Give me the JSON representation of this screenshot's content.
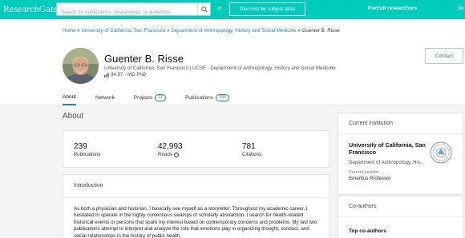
{
  "topbar": {
    "logo": "ResearchGate",
    "search_placeholder": "Search for publications, researchers, or questions",
    "or": "or",
    "discover": "Discover by subject area",
    "recruit": "Recruit researchers",
    "join": "Jo"
  },
  "breadcrumb": {
    "home": "Home",
    "sep": "»",
    "institution": "University of California, San Francisco",
    "department": "Department of Anthropology, History and Social Medicine",
    "current": "Guenter B. Risse"
  },
  "profile": {
    "name": "Guenter B. Risse",
    "affiliation": "University of California, San Francisco | UCSF · Department of Anthropology, History and Social Medicine",
    "score": "34.57",
    "degree": "MD PhD",
    "score_line": "34.57 · MD PhD",
    "contact": "Contact"
  },
  "tabs": [
    {
      "label": "About",
      "badge": null
    },
    {
      "label": "Network",
      "badge": null
    },
    {
      "label": "Projects",
      "badge": "11"
    },
    {
      "label": "Publications",
      "badge": "239"
    }
  ],
  "about": {
    "title": "About",
    "stats": [
      {
        "value": "239",
        "label": "Publications"
      },
      {
        "value": "42,993",
        "label": "Reads"
      },
      {
        "value": "781",
        "label": "Citations"
      }
    ],
    "intro_title": "Introduction",
    "intro_text": "As both a physician and historian, I basically see myself as a storyteller. Throughout my academic career, I hesitated to operate in the highly contentious swamps of scholarly abstraction. I search for health-related historical events or persons that spark my interest based on contemporary concerns and problems. My last two publications attempt to interpret and analyze the role that emotions play in organizing thought, conduct, and social relationships in the history of public health."
  },
  "institution": {
    "title": "Current institution",
    "name": "University of California, San Francisco",
    "department": "Department of Anthropology, His...",
    "position_label": "Current position",
    "position": "Emeritus Professor"
  },
  "coauthors": {
    "title": "Co-authors",
    "top": "Top co-authors"
  },
  "colors": {
    "brand": "#00ccbb",
    "link": "#2b7fb8"
  }
}
